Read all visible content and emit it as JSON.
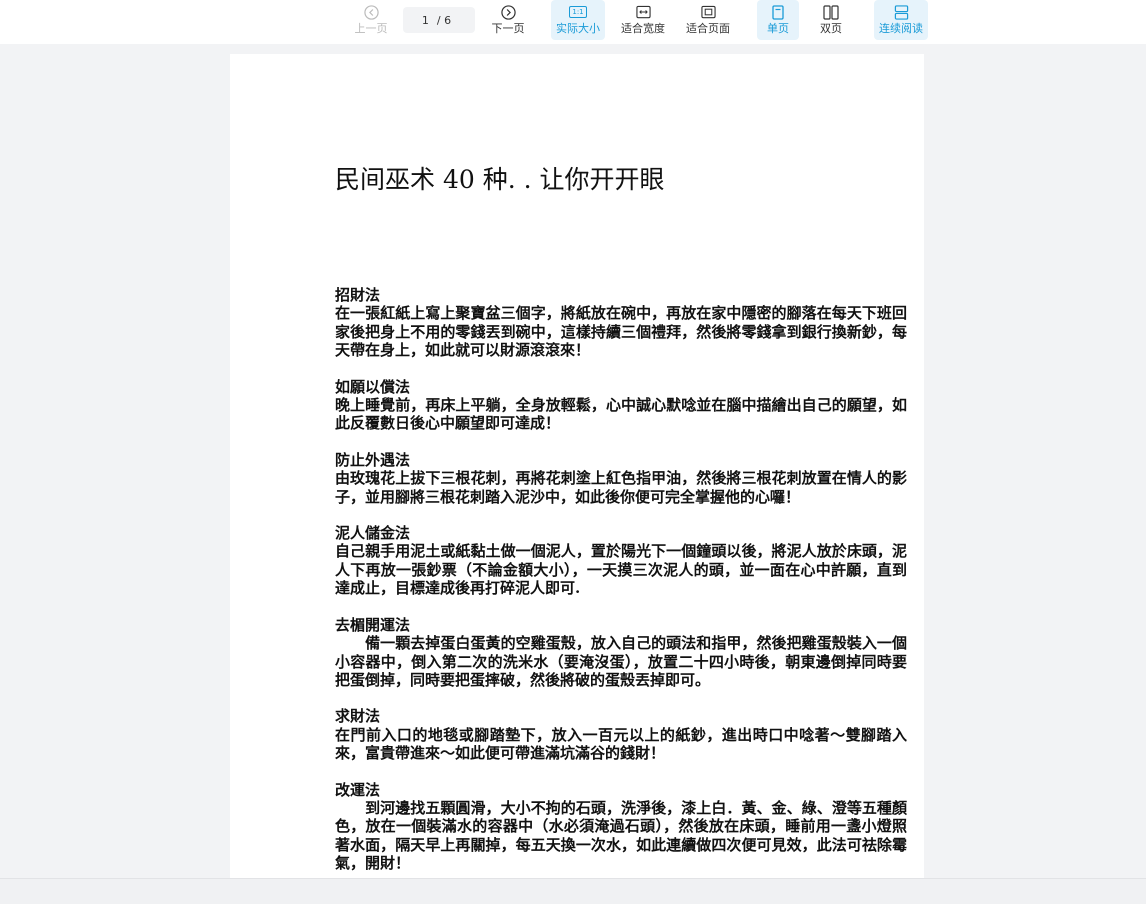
{
  "toolbar": {
    "prev_label": "上一页",
    "current_page": "1",
    "total_pages": "/ 6",
    "next_label": "下一页",
    "actual_size_label": "实际大小",
    "actual_size_icon_text": "1:1",
    "fit_width_label": "适合宽度",
    "fit_page_label": "适合页面",
    "single_page_label": "单页",
    "double_page_label": "双页",
    "continuous_label": "连续阅读",
    "accent_color": "#1a9bd7"
  },
  "document": {
    "title": "民间巫术 40 种. . 让你开开眼",
    "sections": [
      {
        "heading": "招財法",
        "body": "在一張紅紙上寫上聚寶盆三個字，將紙放在碗中，再放在家中隱密的腳落在每天下班回家後把身上不用的零錢丟到碗中，這樣持續三個禮拜，然後將零錢拿到銀行換新鈔，每天帶在身上，如此就可以財源滾滾來！"
      },
      {
        "heading": "如願以償法",
        "body": "晚上睡覺前，再床上平躺，全身放輕鬆，心中誠心默唸並在腦中描繪出自己的願望，如此反覆數日後心中願望即可達成！"
      },
      {
        "heading": "防止外遇法",
        "body": "由玫瑰花上拔下三根花刺，再將花刺塗上紅色指甲油，然後將三根花刺放置在情人的影子，並用腳將三根花刺踏入泥沙中，如此後你便可完全掌握他的心囉！"
      },
      {
        "heading": "泥人儲金法",
        "body": "自己親手用泥土或紙黏土做一個泥人，置於陽光下一個鐘頭以後，將泥人放於床頭，泥人下再放一張鈔票（不論金額大小），一天摸三次泥人的頭，並一面在心中許願，直到達成止，目標達成後再打碎泥人即可."
      },
      {
        "heading": "去楣開運法",
        "body": "　　備一顆去掉蛋白蛋黃的空雞蛋殼，放入自己的頭法和指甲，然後把雞蛋殼裝入一個小容器中，倒入第二次的洗米水（要淹沒蛋），放置二十四小時後，朝東邊倒掉同時要把蛋倒掉，同時要把蛋摔破，然後將破的蛋殼丟掉即可。"
      },
      {
        "heading": "求財法",
        "body": "在門前入口的地毯或腳踏墊下，放入一百元以上的紙鈔，進出時口中唸著～雙腳踏入來，富貴帶進來～如此便可帶進滿坑滿谷的錢財！"
      },
      {
        "heading": "改運法",
        "body": "　　到河邊找五顆圓滑，大小不拘的石頭，洗淨後，漆上白．黃、金、綠、澄等五種顏色，放在一個裝滿水的容器中（水必須淹過石頭），然後放在床頭，睡前用一盞小燈照著水面，隔天早上再關掉，每五天換一次水，如此連續做四次便可見效，此法可祛除霉氣，開財！"
      }
    ]
  }
}
